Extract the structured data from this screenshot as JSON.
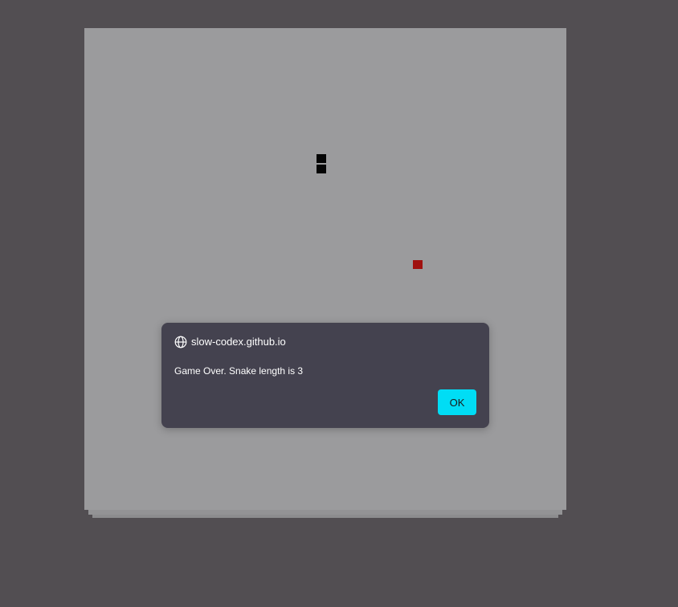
{
  "game": {
    "snake_segments": 2,
    "snake_color": "#050505",
    "food_color": "#a0110f",
    "board_color": "#9b9b9d"
  },
  "dialog": {
    "origin": "slow-codex.github.io",
    "message": "Game Over. Snake length is 3",
    "ok_label": "OK",
    "ok_color": "#00ddf5"
  }
}
